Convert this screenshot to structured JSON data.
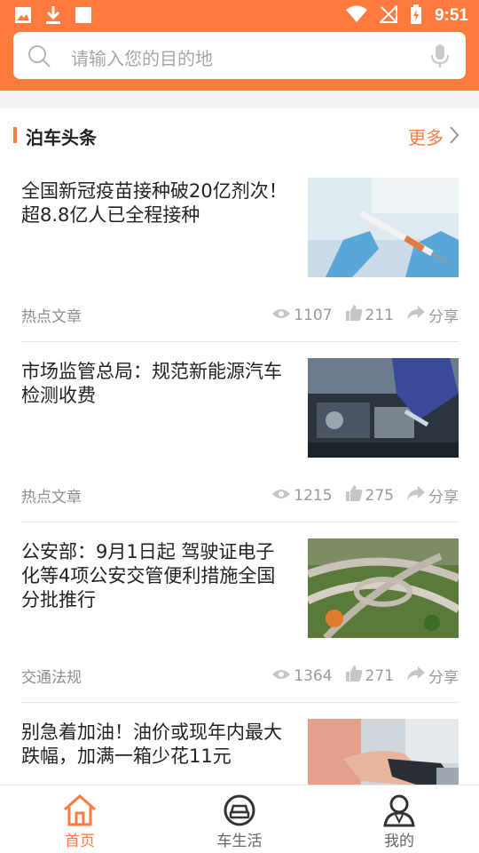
{
  "status_bar": {
    "time": "9:51"
  },
  "search": {
    "placeholder": "请输入您的目的地"
  },
  "section": {
    "title": "泊车头条",
    "more_label": "更多"
  },
  "articles": [
    {
      "title": "全国新冠疫苗接种破20亿剂次！超8.8亿人已全程接种",
      "category": "热点文章",
      "views": "1107",
      "likes": "211",
      "share_label": "分享",
      "image": "vaccine-photo"
    },
    {
      "title": "市场监管总局：规范新能源汽车检测收费",
      "category": "热点文章",
      "views": "1215",
      "likes": "275",
      "share_label": "分享",
      "image": "car-engine-photo"
    },
    {
      "title": "公安部：9月1日起 驾驶证电子化等4项公安交管便利措施全国分批推行",
      "category": "交通法规",
      "views": "1364",
      "likes": "271",
      "share_label": "分享",
      "image": "highway-interchange-photo"
    },
    {
      "title": "别急着加油！油价或现年内最大跌幅，加满一箱少花11元",
      "category": "",
      "views": "",
      "likes": "",
      "share_label": "",
      "image": "fuel-nozzle-photo"
    }
  ],
  "tabs": [
    {
      "label": "首页",
      "icon": "home-icon",
      "active": true
    },
    {
      "label": "车生活",
      "icon": "car-icon",
      "active": false
    },
    {
      "label": "我的",
      "icon": "user-icon",
      "active": false
    }
  ],
  "colors": {
    "accent": "#ff7a3d",
    "text": "#222222",
    "muted": "#8e8e8e"
  }
}
